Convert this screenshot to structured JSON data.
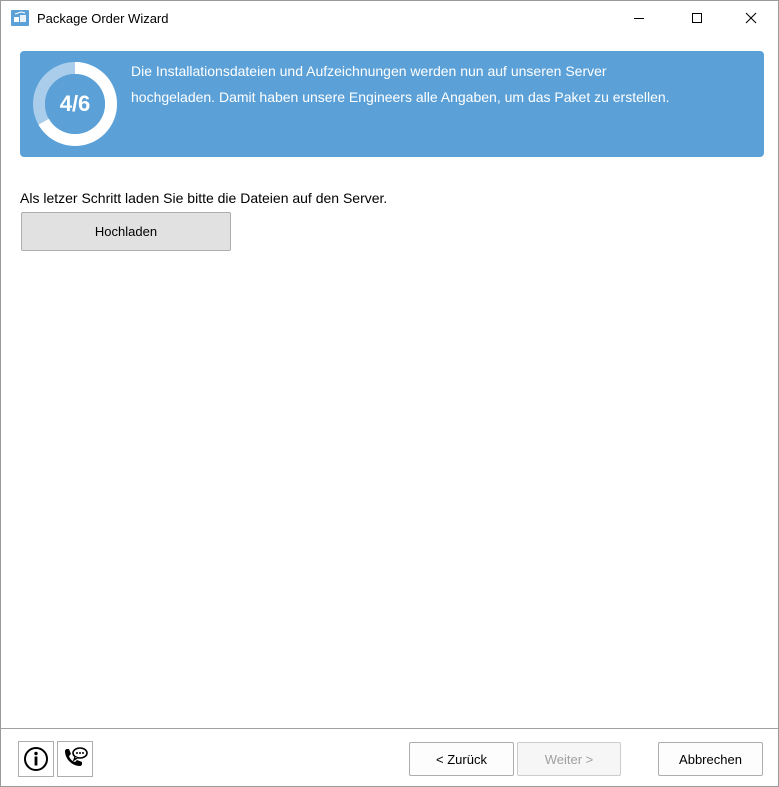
{
  "window": {
    "title": "Package Order Wizard",
    "icons": {
      "app": "package-app-icon",
      "minimize": "minimize-icon",
      "maximize": "maximize-icon",
      "close": "close-icon"
    }
  },
  "banner": {
    "step_text": "4/6",
    "step_progress": 0.6667,
    "line1": "Die Installationsdateien und Aufzeichnungen werden nun auf unseren Server",
    "line2": "hochgeladen. Damit haben unsere Engineers alle Angaben, um das Paket zu erstellen.",
    "color": "#5ba1d8"
  },
  "content": {
    "instruction": "Als letzer Schritt laden Sie bitte die Dateien auf den Server.",
    "upload_button": "Hochladen"
  },
  "footer": {
    "info_icon": "info-icon",
    "support_icon": "phone-chat-icon",
    "back_button": "< Zurück",
    "next_button": "Weiter >",
    "next_enabled": false,
    "cancel_button": "Abbrechen"
  }
}
